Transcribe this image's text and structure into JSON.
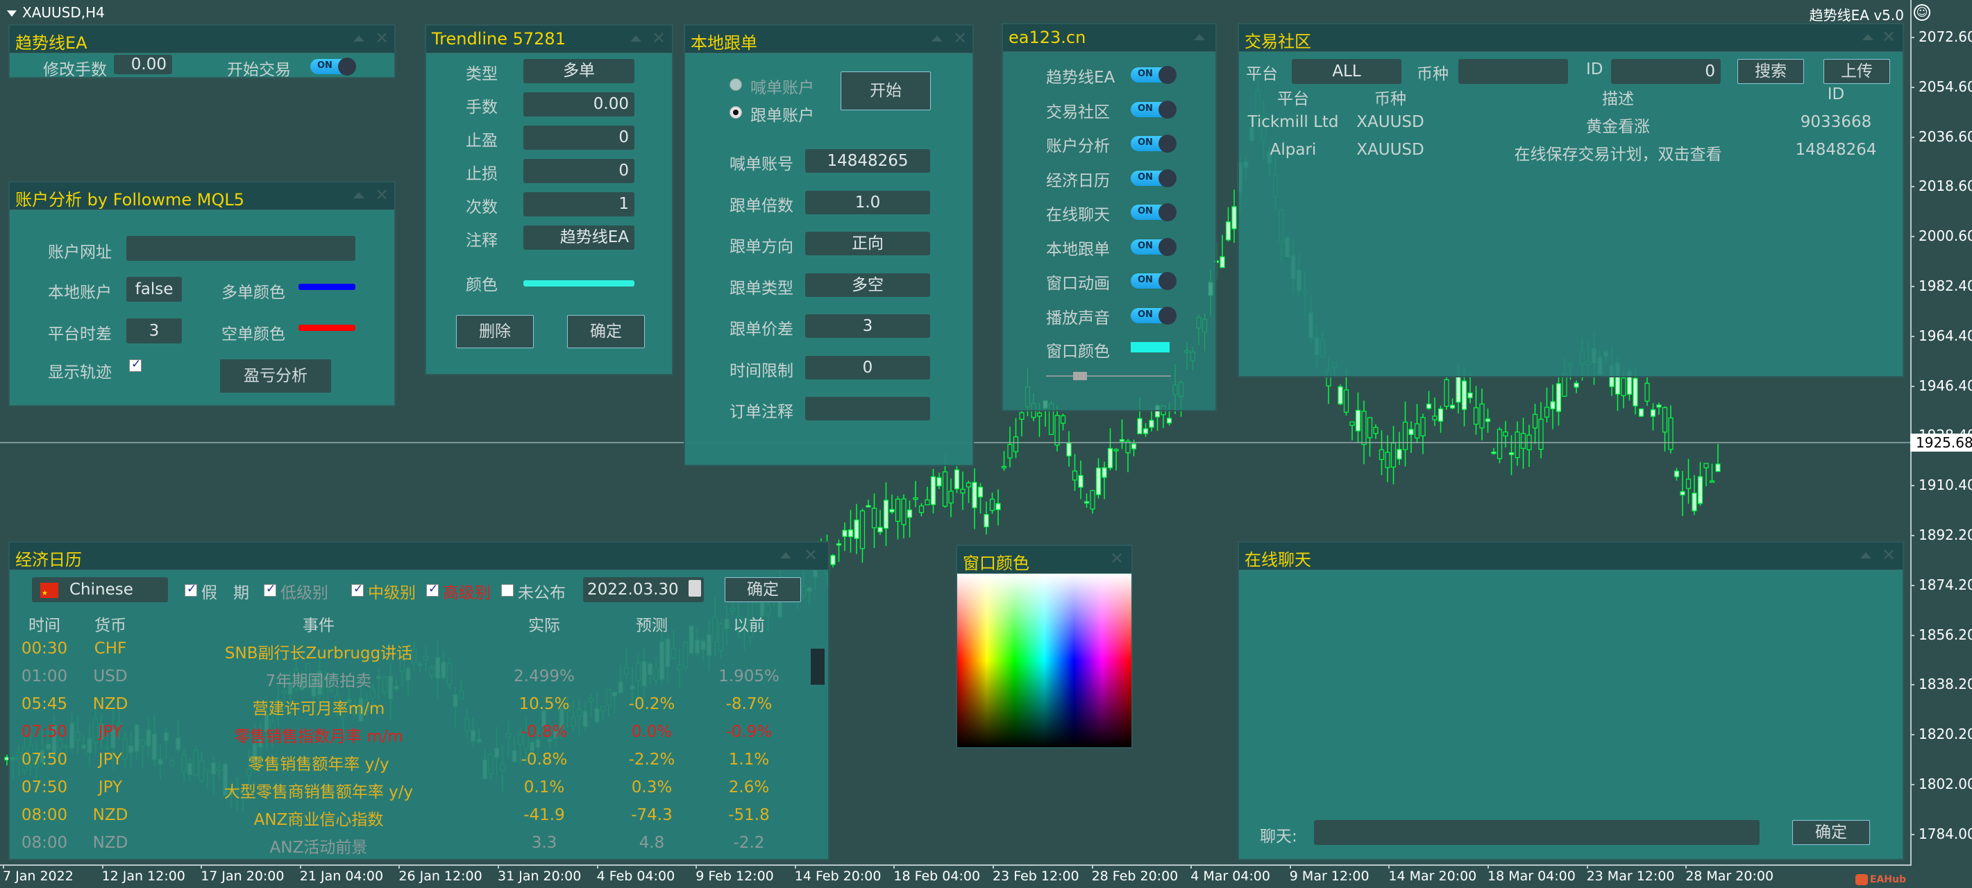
{
  "window": {
    "symbol_title": "XAUUSD,H4",
    "ea_label": "趋势线EA v5.0",
    "smiley_icon": "☺",
    "watermark": "EAHub"
  },
  "price_axis": {
    "labels": [
      "2072.60",
      "2054.60",
      "2036.60",
      "2018.60",
      "2000.60",
      "1982.40",
      "1964.40",
      "1946.40",
      "1928.40",
      "1910.40",
      "1892.20",
      "1874.20",
      "1856.20",
      "1838.20",
      "1820.20",
      "1802.00",
      "1784.00"
    ],
    "current_price": "1925.68"
  },
  "time_axis": {
    "labels": [
      "7 Jan 2022",
      "12 Jan 12:00",
      "17 Jan 20:00",
      "21 Jan 04:00",
      "26 Jan 12:00",
      "31 Jan 20:00",
      "4 Feb 04:00",
      "9 Feb 12:00",
      "14 Feb 20:00",
      "18 Feb 04:00",
      "23 Feb 12:00",
      "28 Feb 20:00",
      "4 Mar 04:00",
      "9 Mar 12:00",
      "14 Mar 20:00",
      "18 Mar 04:00",
      "23 Mar 12:00",
      "28 Mar 20:00"
    ]
  },
  "trend_ea_panel": {
    "title": "趋势线EA",
    "lot_label": "修改手数",
    "lot_value": "0.00",
    "start_trading_label": "开始交易",
    "start_trading_toggle": "ON",
    "minimize_icon": "▲",
    "close_icon": "✕"
  },
  "account_panel": {
    "title": "账户分析 by Followme MQL5",
    "url_label": "账户网址",
    "url_value": "",
    "local_account_label": "本地账户",
    "local_account_value": "false",
    "long_color_label": "多单颜色",
    "long_color": "#0000ff",
    "timezone_label": "平台时差",
    "timezone_value": "3",
    "short_color_label": "空单颜色",
    "short_color": "#ff0000",
    "show_track_label": "显示轨迹",
    "show_track_checked": true,
    "pnl_button": "盈亏分析",
    "minimize_icon": "▲",
    "close_icon": "✕"
  },
  "trendline_panel": {
    "title": "Trendline 57281",
    "fields": [
      {
        "label": "类型",
        "value": "多单"
      },
      {
        "label": "手数",
        "value": "0.00"
      },
      {
        "label": "止盈",
        "value": "0"
      },
      {
        "label": "止损",
        "value": "0"
      },
      {
        "label": "次数",
        "value": "1"
      },
      {
        "label": "注释",
        "value": "趋势线EA"
      }
    ],
    "color_label": "颜色",
    "color_value": "#2ef2e0",
    "delete_button": "删除",
    "confirm_button": "确定",
    "minimize_icon": "▲",
    "close_icon": "✕"
  },
  "copy_panel": {
    "title": "本地跟单",
    "radio_signal": "喊单账户",
    "radio_follow": "跟单账户",
    "selected_radio": "跟单账户",
    "start_button": "开始",
    "fields": [
      {
        "label": "喊单账号",
        "value": "14848265"
      },
      {
        "label": "跟单倍数",
        "value": "1.0"
      },
      {
        "label": "跟单方向",
        "value": "正向"
      },
      {
        "label": "跟单类型",
        "value": "多空"
      },
      {
        "label": "跟单价差",
        "value": "3"
      },
      {
        "label": "时间限制",
        "value": "0"
      },
      {
        "label": "订单注释",
        "value": ""
      }
    ],
    "minimize_icon": "▲",
    "close_icon": "✕"
  },
  "settings_panel": {
    "title": "ea123.cn",
    "toggles": [
      {
        "label": "趋势线EA",
        "state": "ON"
      },
      {
        "label": "交易社区",
        "state": "ON"
      },
      {
        "label": "账户分析",
        "state": "ON"
      },
      {
        "label": "经济日历",
        "state": "ON"
      },
      {
        "label": "在线聊天",
        "state": "ON"
      },
      {
        "label": "本地跟单",
        "state": "ON"
      },
      {
        "label": "窗口动画",
        "state": "ON"
      },
      {
        "label": "播放声音",
        "state": "ON"
      }
    ],
    "window_color_label": "窗口颜色",
    "window_color": "#1ef2e6",
    "opacity_slider": 0.27,
    "minimize_icon": "▲"
  },
  "community_panel": {
    "title": "交易社区",
    "platform_label": "平台",
    "platform_value": "ALL",
    "symbol_label": "币种",
    "symbol_value": "",
    "id_label": "ID",
    "id_value": "0",
    "search_button": "搜索",
    "upload_button": "上传",
    "columns": [
      "平台",
      "币种",
      "描述",
      "ID"
    ],
    "rows": [
      [
        "Tickmill Ltd",
        "XAUUSD",
        "黄金看涨",
        "9033668"
      ],
      [
        "Alpari",
        "XAUUSD",
        "在线保存交易计划，双击查看",
        "14848264"
      ]
    ],
    "minimize_icon": "▲",
    "close_icon": "✕"
  },
  "calendar_panel": {
    "title": "经济日历",
    "language": "Chinese",
    "filters": [
      {
        "label": "假　期",
        "checked": true,
        "color": "#c8d3d3"
      },
      {
        "label": "低级别",
        "checked": true,
        "color": "#8a9a9a"
      },
      {
        "label": "中级别",
        "checked": true,
        "color": "#e0b020"
      },
      {
        "label": "高级别",
        "checked": true,
        "color": "#e02020"
      },
      {
        "label": "未公布",
        "checked": false,
        "color": "#c8d3d3"
      }
    ],
    "date": "2022.03.30",
    "confirm_button": "确定",
    "columns": [
      "时间",
      "货币",
      "事件",
      "实际",
      "预测",
      "以前"
    ],
    "rows": [
      {
        "time": "00:30",
        "currency": "CHF",
        "event": "SNB副行长Zurbrugg讲话",
        "actual": "",
        "forecast": "",
        "previous": "",
        "level": "medium"
      },
      {
        "time": "01:00",
        "currency": "USD",
        "event": "7年期国债拍卖",
        "actual": "2.499%",
        "forecast": "",
        "previous": "1.905%",
        "level": "low"
      },
      {
        "time": "05:45",
        "currency": "NZD",
        "event": "营建许可月率m/m",
        "actual": "10.5%",
        "forecast": "-0.2%",
        "previous": "-8.7%",
        "level": "medium"
      },
      {
        "time": "07:50",
        "currency": "JPY",
        "event": "零售销售指数月率 m/m",
        "actual": "-0.8%",
        "forecast": "0.0%",
        "previous": "-0.9%",
        "level": "high"
      },
      {
        "time": "07:50",
        "currency": "JPY",
        "event": "零售销售额年率 y/y",
        "actual": "-0.8%",
        "forecast": "-2.2%",
        "previous": "1.1%",
        "level": "medium"
      },
      {
        "time": "07:50",
        "currency": "JPY",
        "event": "大型零售商销售额年率 y/y",
        "actual": "0.1%",
        "forecast": "0.3%",
        "previous": "2.6%",
        "level": "medium"
      },
      {
        "time": "08:00",
        "currency": "NZD",
        "event": "ANZ商业信心指数",
        "actual": "-41.9",
        "forecast": "-74.3",
        "previous": "-51.8",
        "level": "medium"
      },
      {
        "time": "08:00",
        "currency": "NZD",
        "event": "ANZ活动前景",
        "actual": "3.3",
        "forecast": "4.8",
        "previous": "-2.2",
        "level": "low"
      }
    ],
    "level_colors": {
      "low": "#8a9a9a",
      "medium": "#e0b020",
      "high": "#e02020"
    },
    "minimize_icon": "▲",
    "close_icon": "✕"
  },
  "color_panel": {
    "title": "窗口颜色",
    "close_icon": "✕"
  },
  "chat_panel": {
    "title": "在线聊天",
    "chat_label": "聊天:",
    "chat_value": "",
    "send_button": "确定",
    "minimize_icon": "▲",
    "close_icon": "✕"
  },
  "colors": {
    "background": "#2f4f4f",
    "panel": "#28807a",
    "panel_header": "#1f4a4c",
    "title_text": "#f2d500",
    "candle": "#00ff40"
  }
}
